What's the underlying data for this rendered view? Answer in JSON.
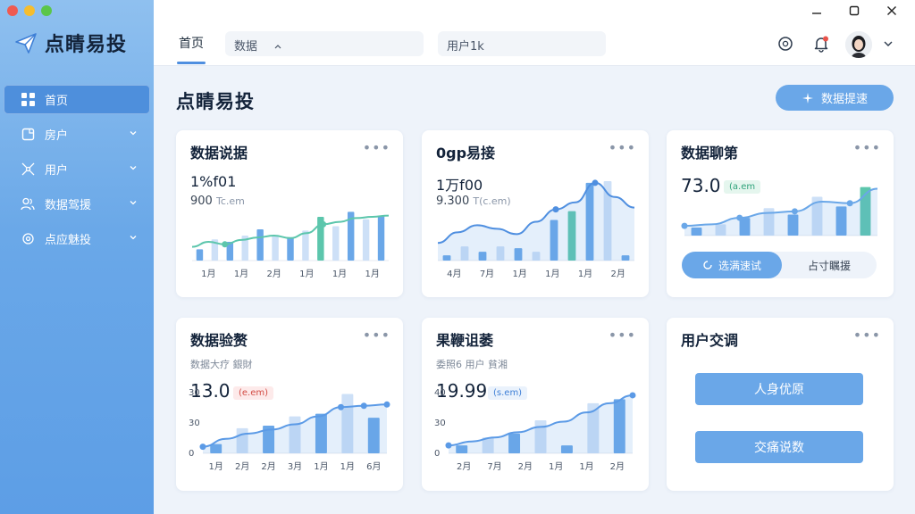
{
  "app": {
    "name": "点睛易投"
  },
  "nav": {
    "items": [
      {
        "label": "首页",
        "icon": "grid-icon"
      },
      {
        "label": "房户",
        "icon": "document-icon"
      },
      {
        "label": "用户",
        "icon": "network-icon"
      },
      {
        "label": "数据驾援",
        "icon": "users-icon"
      },
      {
        "label": "点应魅投",
        "icon": "settings-icon"
      }
    ]
  },
  "topbar": {
    "tab_home": "首页",
    "field_data": "数据",
    "field_user": "用户1k"
  },
  "page": {
    "title": "点睛易投",
    "primary_button": "数据提速"
  },
  "cards": {
    "c1": {
      "title": "数据说据",
      "stat": "1%f01",
      "sub_value": "900",
      "sub_unit": "Tc.em",
      "chart_data": {
        "type": "bar",
        "categories": [
          "1月",
          "1月",
          "2月",
          "1月",
          "1月",
          "1月"
        ],
        "values": [
          18,
          34,
          30,
          40,
          50,
          40,
          36,
          48,
          70,
          55,
          78,
          66,
          72
        ],
        "line": [
          22,
          30,
          26,
          33,
          37,
          40,
          36,
          44,
          58,
          62,
          68,
          70,
          72
        ]
      }
    },
    "c2": {
      "title": "0gp易接",
      "stat": "1万f00",
      "sub_value": "9.300",
      "sub_unit": "T(c.em)",
      "chart_data": {
        "type": "bar",
        "categories": [
          "4月",
          "7月",
          "1月",
          "1月",
          "1月",
          "2月"
        ],
        "values": [
          6,
          16,
          10,
          16,
          14,
          10,
          46,
          56,
          88,
          90,
          6
        ],
        "line": [
          20,
          32,
          40,
          36,
          30,
          44,
          58,
          66,
          88,
          72,
          60
        ]
      }
    },
    "c3": {
      "title": "数据聊第",
      "stat": "73.0",
      "badge": "(a.em",
      "seg_on": "选满速试",
      "seg_off": "占寸瞩援",
      "chart_data": {
        "type": "bar",
        "values": [
          10,
          14,
          22,
          34,
          26,
          48,
          36,
          60
        ],
        "line": [
          12,
          14,
          22,
          28,
          30,
          42,
          40,
          58
        ]
      }
    },
    "c4": {
      "title": "数据验赘",
      "subtitle": "数据大疗 銀財",
      "stat": "13.0",
      "badge": "(e.em)",
      "chart_data": {
        "type": "bar",
        "categories": [
          "1月",
          "2月",
          "2月",
          "3月",
          "1月",
          "1月",
          "6月"
        ],
        "y_ticks": [
          "30",
          "30",
          "0"
        ],
        "values": [
          14,
          38,
          42,
          56,
          60,
          90,
          54
        ],
        "line": [
          10,
          22,
          30,
          36,
          44,
          56,
          70,
          72,
          74
        ]
      }
    },
    "c5": {
      "title": "果鞭诅萎",
      "subtitle": "委照6 用户 貧湘",
      "stat": "19.99",
      "badge": "(s.em)",
      "chart_data": {
        "type": "bar",
        "categories": [
          "2月",
          "7月",
          "2月",
          "1月",
          "1月",
          "2月"
        ],
        "y_ticks": [
          "40",
          "30",
          "0"
        ],
        "values": [
          12,
          24,
          30,
          50,
          12,
          76,
          82
        ],
        "line": [
          12,
          18,
          24,
          32,
          40,
          48,
          62,
          76,
          88
        ]
      }
    },
    "c6": {
      "title": "用户交调",
      "button1": "人身优原",
      "button2": "交痛说数"
    }
  },
  "colors": {
    "accent": "#4f8fe0",
    "bar": "#6aa7e8",
    "bar_light": "#cde0f7",
    "teal": "#5cc6ac"
  }
}
